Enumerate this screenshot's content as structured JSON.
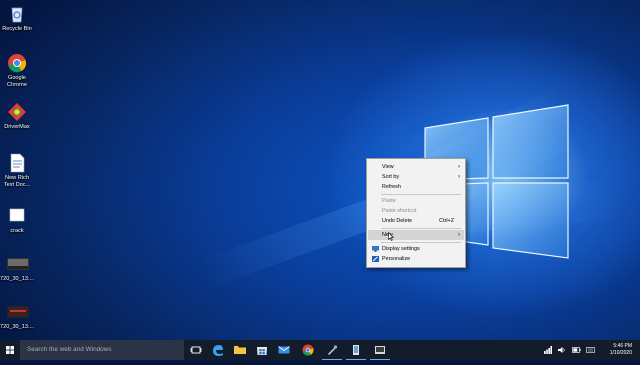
{
  "desktop_icons": [
    {
      "label": "Recycle Bin",
      "icon": "recycle-bin-icon"
    },
    {
      "label": "Google Chrome",
      "icon": "chrome-icon"
    },
    {
      "label": "DriverMax",
      "icon": "drivermax-icon"
    },
    {
      "label": "New Rich Text Doc...",
      "icon": "rtf-document-icon"
    },
    {
      "label": "crack",
      "icon": "blank-file-icon"
    },
    {
      "label": "720_30_13....",
      "icon": "video-thumbnail-icon"
    },
    {
      "label": "720_30_13....",
      "icon": "video-thumbnail-icon"
    }
  ],
  "context_menu": {
    "view": "View",
    "sort_by": "Sort by",
    "refresh": "Refresh",
    "paste": "Paste",
    "paste_shortcut": "Paste shortcut",
    "undo_delete": "Undo Delete",
    "undo_shortcut": "Ctrl+Z",
    "new": "New",
    "display_settings": "Display settings",
    "personalize": "Personalize",
    "submenu_arrow": "›"
  },
  "taskbar": {
    "search_placeholder": "Search the web and Windows",
    "pinned": [
      "task-view-icon",
      "edge-icon",
      "file-explorer-icon",
      "store-icon",
      "mail-icon",
      "chrome-icon",
      "app-icon",
      "app-icon",
      "app-icon"
    ],
    "clock_time": "5:46 PM",
    "clock_date": "1/10/2020"
  },
  "colors": {
    "desktop_accent": "#0d56c6",
    "taskbar": "#121c2b",
    "menu_bg": "#f2f2f2",
    "menu_highlight": "#d4d4d4"
  }
}
